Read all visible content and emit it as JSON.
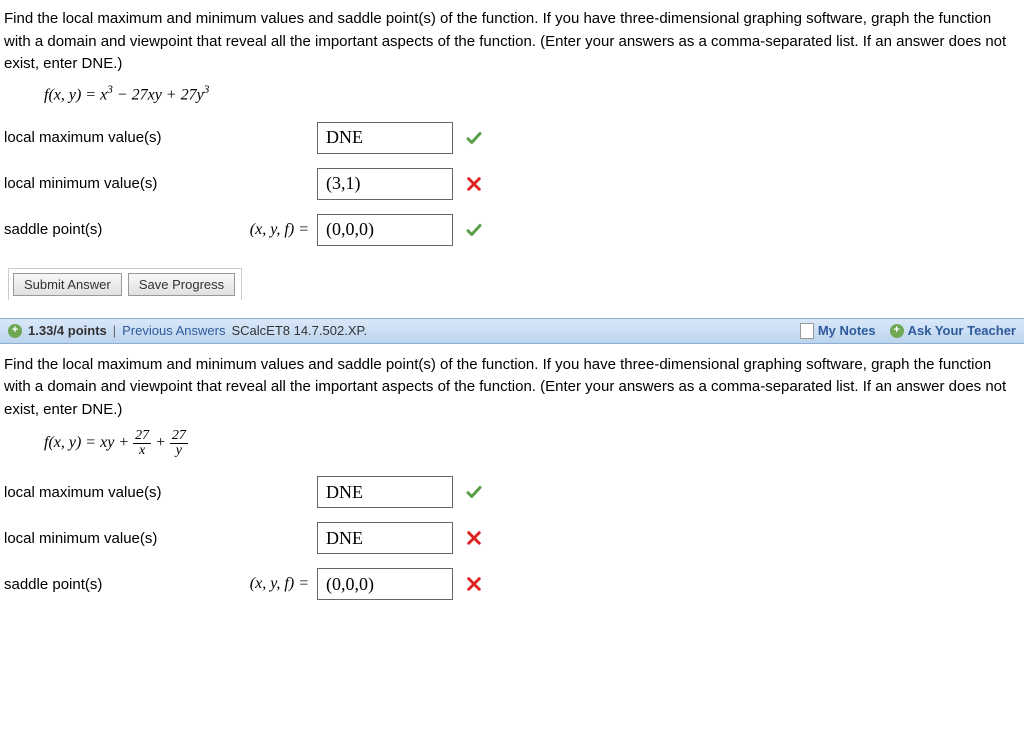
{
  "q1": {
    "instructions": "Find the local maximum and minimum values and saddle point(s) of the function. If you have three-dimensional graphing software, graph the function with a domain and viewpoint that reveal all the important aspects of the function. (Enter your answers as a comma-separated list. If an answer does not exist, enter DNE.)",
    "formula_html": "f(x, y) = x<sup>3</sup> − 27xy + 27y<sup>3</sup>",
    "labels": {
      "max": "local maximum value(s)",
      "min": "local minimum value(s)",
      "saddle": "saddle point(s)",
      "saddle_prefix": "(x, y, f)  ="
    },
    "answers": {
      "max": "DNE",
      "min": "(3,1)",
      "saddle": "(0,0,0)"
    },
    "feedback": {
      "max": "correct",
      "min": "incorrect",
      "saddle": "correct"
    },
    "buttons": {
      "submit": "Submit Answer",
      "save": "Save Progress"
    }
  },
  "q2": {
    "header": {
      "points": "1.33/4 points",
      "previous": "Previous Answers",
      "ref": "SCalcET8 14.7.502.XP.",
      "mynotes": "My Notes",
      "ask": "Ask Your Teacher"
    },
    "instructions": "Find the local maximum and minimum values and saddle point(s) of the function. If you have three-dimensional graphing software, graph the function with a domain and viewpoint that reveal all the important aspects of the function. (Enter your answers as a comma-separated list. If an answer does not exist, enter DNE.)",
    "formula_parts": {
      "lead": "f(x, y) = xy + ",
      "n1": "27",
      "d1": "x",
      "plus": " + ",
      "n2": "27",
      "d2": "y"
    },
    "labels": {
      "max": "local maximum value(s)",
      "min": "local minimum value(s)",
      "saddle": "saddle point(s)",
      "saddle_prefix": "(x, y, f)  ="
    },
    "answers": {
      "max": "DNE",
      "min": "DNE",
      "saddle": "(0,0,0)"
    },
    "feedback": {
      "max": "correct",
      "min": "incorrect",
      "saddle": "incorrect"
    }
  }
}
